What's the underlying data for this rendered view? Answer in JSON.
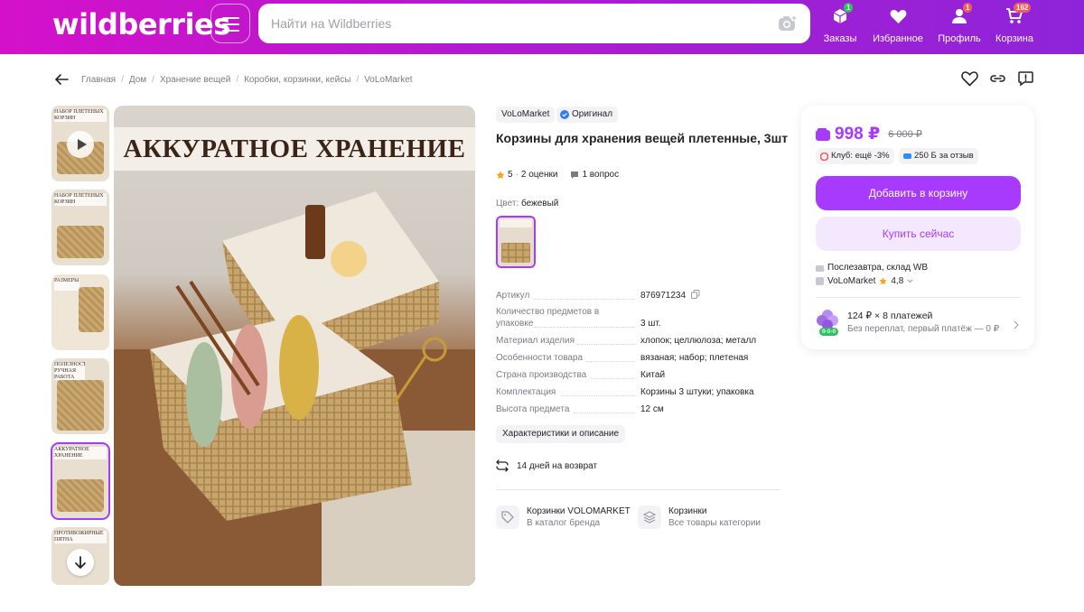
{
  "header": {
    "logo": "wildberries",
    "search_placeholder": "Найти на Wildberries",
    "nav": [
      {
        "label": "Заказы",
        "badge": "1"
      },
      {
        "label": "Избранное",
        "badge": ""
      },
      {
        "label": "Профиль",
        "badge": "1"
      },
      {
        "label": "Корзина",
        "badge": "162"
      }
    ]
  },
  "breadcrumb": [
    "Главная",
    "Дом",
    "Хранение вещей",
    "Коробки, корзинки, кейсы",
    "VoLoMarket"
  ],
  "gallery": {
    "banner_text": "АККУРАТНОЕ ХРАНЕНИЕ",
    "thumbs": [
      {
        "caption": "НАБОР ПЛЕТЁНЫХ КОРЗИН"
      },
      {
        "caption": "НАБОР ПЛЕТЁНЫХ КОРЗИН"
      },
      {
        "caption": "РАЗМЕРЫ"
      },
      {
        "caption": "ПОЛЕЗНОСТЬ РУЧНАЯ РАБОТА"
      },
      {
        "caption": "АККУРАТНОЕ ХРАНЕНИЕ"
      },
      {
        "caption": "ПРОТИВОЖИРНЫЕ ПЯТНА"
      }
    ]
  },
  "product": {
    "seller": "VoLoMarket",
    "original": "Оригинал",
    "title": "Корзины для хранения вещей плетенные, 3шт",
    "rating": "5",
    "reviews": "2 оценки",
    "questions": "1 вопрос",
    "color_key": "Цвет:",
    "color_value": "бежевый",
    "specs": [
      {
        "key": "Артикул",
        "value": "876971234"
      },
      {
        "key": "Количество предметов в упаковке",
        "value": "3 шт."
      },
      {
        "key": "Материал изделия",
        "value": "хлопок; целлюлоза; металл"
      },
      {
        "key": "Особенности товара",
        "value": "вязаная; набор; плетеная"
      },
      {
        "key": "Страна производства",
        "value": "Китай"
      },
      {
        "key": "Комплектация",
        "value": "Корзины 3 штуки; упаковка"
      },
      {
        "key": "Высота предмета",
        "value": "12 см"
      }
    ],
    "char_button": "Характеристики и описание",
    "returns": "14 дней на возврат",
    "brand_links": [
      {
        "title": "Корзинки VOLOMARKET",
        "sub": "В каталог бренда"
      },
      {
        "title": "Корзинки",
        "sub": "Все товары категории"
      }
    ]
  },
  "price_card": {
    "price": "998 ₽",
    "old_price": "6 000 ₽",
    "club_chip": "Клуб: ещё -3%",
    "bonus_chip": "250 Б",
    "bonus_tail": "за отзыв",
    "add_to_cart": "Добавить в корзину",
    "buy_now": "Купить сейчас",
    "delivery": "Послезавтра, склад WB",
    "seller": "VoLoMarket",
    "seller_rating": "4,8",
    "installment_main": "124 ₽ × 8 платежей",
    "installment_sub": "Без переплат, первый платёж — 0 ₽",
    "split_badge": "0·0·0"
  },
  "colors": {
    "brand_gradient_start": "#d411c9",
    "brand_gradient_end": "#8e24d9",
    "accent": "#a73afd",
    "success": "#2cc25d",
    "star": "#ff9f1a"
  }
}
